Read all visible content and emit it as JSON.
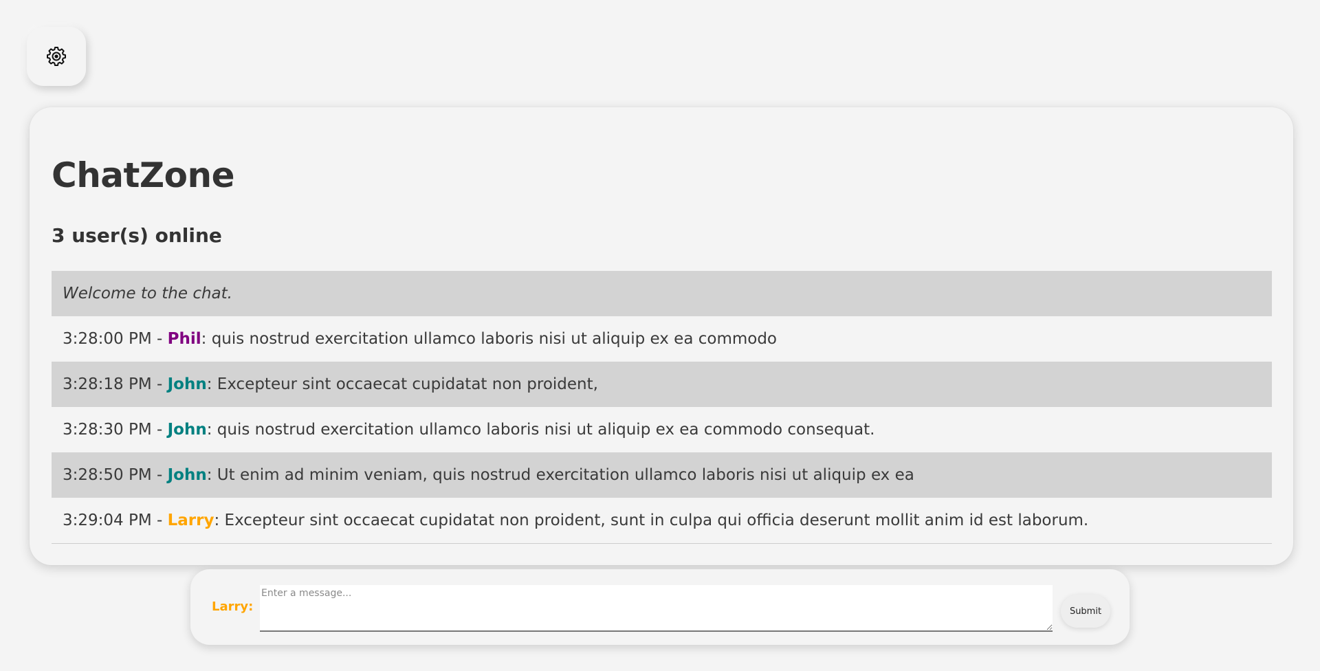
{
  "settings": {
    "icon": "gear-icon"
  },
  "chat": {
    "title": "ChatZone",
    "users_online": "3 user(s) online",
    "messages": [
      {
        "system": true,
        "text": "Welcome to the chat."
      },
      {
        "time": "3:28:00 PM",
        "user": "Phil",
        "color": "#800080",
        "text": "quis nostrud exercitation ullamco laboris nisi ut aliquip ex ea commodo"
      },
      {
        "time": "3:28:18 PM",
        "user": "John",
        "color": "#008080",
        "text": "Excepteur sint occaecat cupidatat non proident,"
      },
      {
        "time": "3:28:30 PM",
        "user": "John",
        "color": "#008080",
        "text": "quis nostrud exercitation ullamco laboris nisi ut aliquip ex ea commodo consequat."
      },
      {
        "time": "3:28:50 PM",
        "user": "John",
        "color": "#008080",
        "text": "Ut enim ad minim veniam, quis nostrud exercitation ullamco laboris nisi ut aliquip ex ea"
      },
      {
        "time": "3:29:04 PM",
        "user": "Larry",
        "color": "#FFA500",
        "text": "Excepteur sint occaecat cupidatat non proident, sunt in culpa qui officia deserunt mollit anim id est laborum."
      }
    ]
  },
  "composer": {
    "user_label": "Larry:",
    "user_color": "#FFA500",
    "placeholder": "Enter a message...",
    "value": "",
    "submit_label": "Submit"
  }
}
